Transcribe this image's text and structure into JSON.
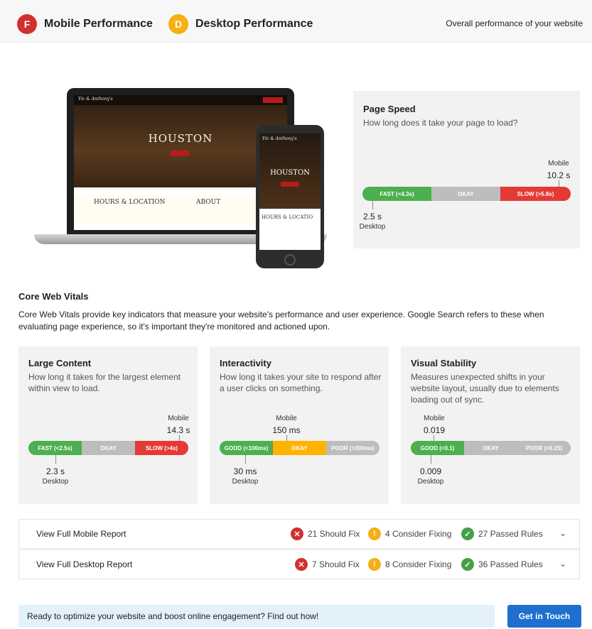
{
  "header": {
    "mobile_tab": {
      "grade": "F",
      "label": "Mobile Performance"
    },
    "desktop_tab": {
      "grade": "D",
      "label": "Desktop Performance"
    },
    "overall": "Overall performance of your website"
  },
  "illustration": {
    "site_logo": "Vic & Anthony's",
    "hero_title": "HOUSTON",
    "laptop_section_1": "HOURS & LOCATION",
    "laptop_section_2": "ABOUT",
    "phone_section": "HOURS & LOCATIO"
  },
  "page_speed": {
    "title": "Page Speed",
    "description": "How long does it take your page to load?",
    "mobile_label": "Mobile",
    "mobile_value": "10.2 s",
    "desktop_value": "2.5 s",
    "desktop_label": "Desktop",
    "bar": [
      "FAST (<4.3s)",
      "OKAY",
      "SLOW (>5.8s)"
    ]
  },
  "core_web_vitals": {
    "title": "Core Web Vitals",
    "description": "Core Web Vitals provide key indicators that measure your website's performance and user experience. Google Search refers to these when evaluating page experience, so it's important they're monitored and actioned upon.",
    "cards": [
      {
        "title": "Large Content",
        "description": "How long it takes for the largest element within view to load.",
        "mobile_label": "Mobile",
        "mobile_value": "14.3 s",
        "desktop_value": "2.3 s",
        "desktop_label": "Desktop",
        "bar": [
          "FAST (<2.5s)",
          "OKAY",
          "SLOW (>4s)"
        ]
      },
      {
        "title": "Interactivity",
        "description": "How long it takes your site to respond after a user clicks on something.",
        "mobile_label": "Mobile",
        "mobile_value": "150 ms",
        "desktop_value": "30 ms",
        "desktop_label": "Desktop",
        "bar": [
          "GOOD (<100ms)",
          "OKAY",
          "POOR (>300ms)"
        ]
      },
      {
        "title": "Visual Stability",
        "description": "Measures unexpected shifts in your website layout, usually due to elements loading out of sync.",
        "mobile_label": "Mobile",
        "mobile_value": "0.019",
        "desktop_value": "0.009",
        "desktop_label": "Desktop",
        "bar": [
          "GOOD (<0.1)",
          "OKAY",
          "POOR (>0.25)"
        ]
      }
    ]
  },
  "reports": [
    {
      "label": "View Full Mobile Report",
      "should_fix": "21 Should Fix",
      "consider": "4 Consider Fixing",
      "passed": "27 Passed Rules"
    },
    {
      "label": "View Full Desktop Report",
      "should_fix": "7 Should Fix",
      "consider": "8 Consider Fixing",
      "passed": "36 Passed Rules"
    }
  ],
  "icons": {
    "fail": "x-circle-icon",
    "warn": "exclamation-circle-icon",
    "pass": "check-circle-icon",
    "expand": "chevron-down-icon"
  },
  "colors": {
    "fast_good": "#4caf50",
    "okay_gray": "#bdbdbd",
    "okay_amber": "#ffb300",
    "slow_poor": "#e53935",
    "grade_f": "#d32f2f",
    "grade_d": "#f5b014",
    "cta": "#1e6fd0"
  },
  "footer": {
    "message": "Ready to optimize your website and boost online engagement? Find out how!",
    "button": "Get in Touch"
  }
}
